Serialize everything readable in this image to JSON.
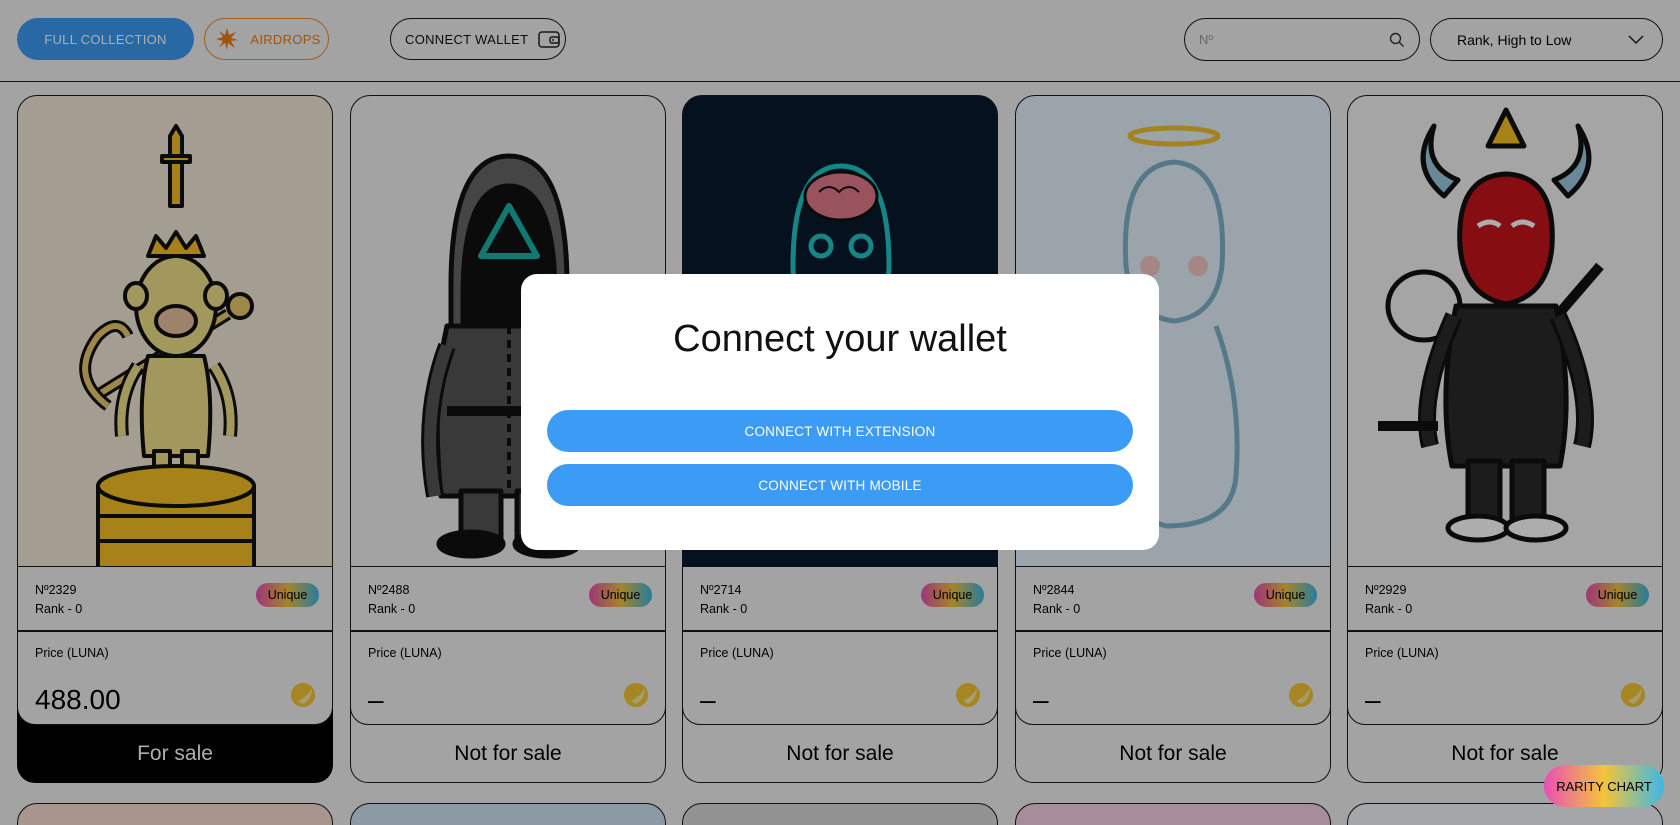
{
  "header": {
    "full_collection": "FULL COLLECTION",
    "airdrops": "AIRDROPS",
    "connect_wallet": "CONNECT WALLET",
    "search_placeholder": "Nº",
    "sort_value": "Rank, High to Low"
  },
  "cards": [
    {
      "number": "Nº2329",
      "rank": "Rank - 0",
      "badge": "Unique",
      "price_label": "Price (LUNA)",
      "price": "488.00",
      "status": "For sale",
      "bg": "#f0e9d6"
    },
    {
      "number": "Nº2488",
      "rank": "Rank - 0",
      "badge": "Unique",
      "price_label": "Price (LUNA)",
      "price": "–",
      "status": "Not for sale",
      "bg": "#f1f1f1"
    },
    {
      "number": "Nº2714",
      "rank": "Rank - 0",
      "badge": "Unique",
      "price_label": "Price (LUNA)",
      "price": "–",
      "status": "Not for sale",
      "bg": "#0a1a2e"
    },
    {
      "number": "Nº2844",
      "rank": "Rank - 0",
      "badge": "Unique",
      "price_label": "Price (LUNA)",
      "price": "–",
      "status": "Not for sale",
      "bg": "#e4f2fb"
    },
    {
      "number": "Nº2929",
      "rank": "Rank - 0",
      "badge": "Unique",
      "price_label": "Price (LUNA)",
      "price": "–",
      "status": "Not for sale",
      "bg": "#f3f3f3"
    }
  ],
  "rarity_chart": "RARITY CHART",
  "modal": {
    "title": "Connect your wallet",
    "extension": "CONNECT WITH EXTENSION",
    "mobile": "CONNECT WITH MOBILE"
  },
  "colors": {
    "accent": "#3c9bf4",
    "airdrops": "#f07a10"
  }
}
